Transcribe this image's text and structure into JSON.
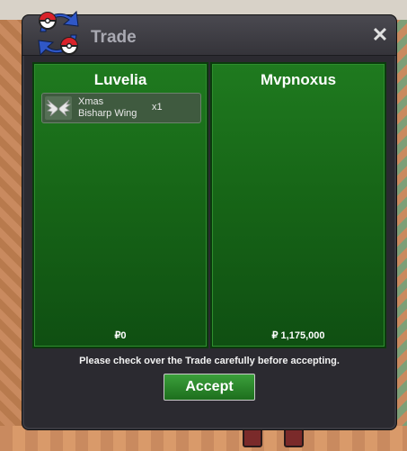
{
  "window": {
    "title": "Trade",
    "close_glyph": "✕"
  },
  "trade": {
    "left": {
      "player": "Luvelia",
      "money": "₽0",
      "items": [
        {
          "icon": "wing-icon",
          "name_line1": "Xmas",
          "name_line2": "Bisharp Wing",
          "qty": "x1"
        }
      ]
    },
    "right": {
      "player": "Mvpnoxus",
      "money": "₽ 1,175,000",
      "items": []
    }
  },
  "footer": {
    "notice": "Please check over the Trade carefully before accepting.",
    "accept_label": "Accept"
  }
}
